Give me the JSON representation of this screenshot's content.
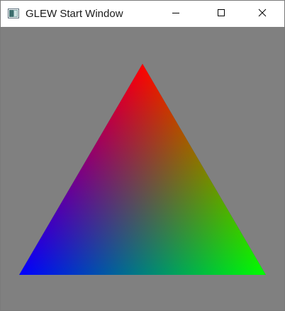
{
  "window": {
    "title": "GLEW Start Window",
    "icon": "application-window-icon",
    "buttons": {
      "minimize": "minimize-icon",
      "maximize": "maximize-icon",
      "close": "close-icon"
    }
  },
  "canvas": {
    "background_color": "#808080",
    "triangle": {
      "vertex_colors": {
        "top": "#ff0000",
        "bottom_left": "#0000ff",
        "bottom_right": "#00ff00"
      }
    }
  }
}
